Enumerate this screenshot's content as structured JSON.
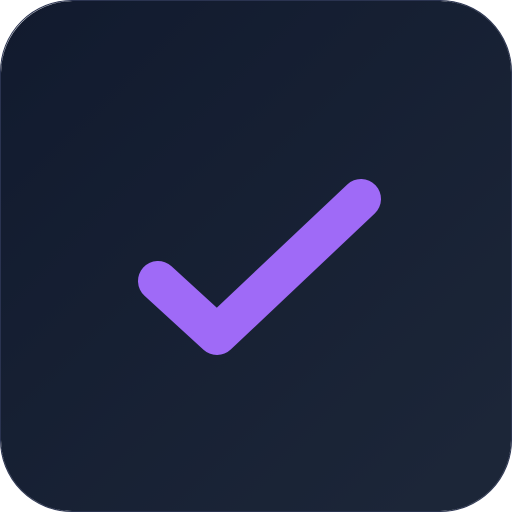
{
  "icon": {
    "name": "check-icon",
    "colors": {
      "background_top": "#111a2e",
      "background_bottom": "#1d2739",
      "checkmark": "#9f6af7"
    }
  }
}
